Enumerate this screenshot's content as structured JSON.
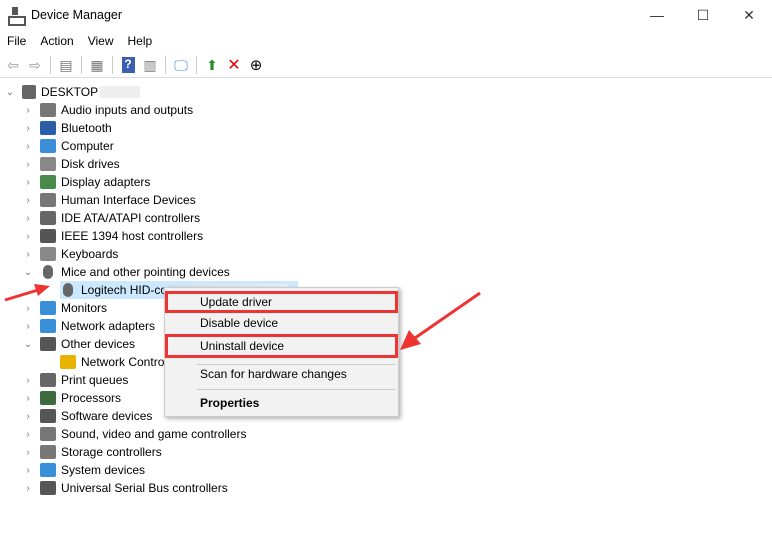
{
  "window": {
    "title": "Device Manager",
    "minimize": "—",
    "maximize": "☐",
    "close": "✕"
  },
  "menubar": [
    "File",
    "Action",
    "View",
    "Help"
  ],
  "toolbar": [
    "back",
    "forward",
    "show-hide-console-tree",
    "properties",
    "help",
    "action-pane",
    "scan-hardware",
    "update-driver",
    "uninstall",
    "disable"
  ],
  "tree": {
    "root": "DESKTOP",
    "items": [
      {
        "label": "Audio inputs and outputs",
        "expanded": false,
        "icon": "speaker",
        "color": "#777"
      },
      {
        "label": "Bluetooth",
        "expanded": false,
        "icon": "bluetooth",
        "color": "#2a5ea8"
      },
      {
        "label": "Computer",
        "expanded": false,
        "icon": "monitor",
        "color": "#3a8fd8"
      },
      {
        "label": "Disk drives",
        "expanded": false,
        "icon": "disk",
        "color": "#888"
      },
      {
        "label": "Display adapters",
        "expanded": false,
        "icon": "display",
        "color": "#4a8a4a"
      },
      {
        "label": "Human Interface Devices",
        "expanded": false,
        "icon": "hid",
        "color": "#777"
      },
      {
        "label": "IDE ATA/ATAPI controllers",
        "expanded": false,
        "icon": "ide",
        "color": "#666"
      },
      {
        "label": "IEEE 1394 host controllers",
        "expanded": false,
        "icon": "ieee",
        "color": "#555"
      },
      {
        "label": "Keyboards",
        "expanded": false,
        "icon": "keyboard",
        "color": "#888"
      },
      {
        "label": "Mice and other pointing devices",
        "expanded": true,
        "icon": "mouse",
        "color": "#666"
      },
      {
        "label": "Logitech HID-co",
        "child": true,
        "selected": true,
        "icon": "mouse",
        "color": "#666"
      },
      {
        "label": "Monitors",
        "expanded": false,
        "icon": "monitor",
        "color": "#3a8fd8"
      },
      {
        "label": "Network adapters",
        "expanded": false,
        "icon": "network",
        "color": "#3a8fd8"
      },
      {
        "label": "Other devices",
        "expanded": true,
        "icon": "unknown",
        "color": "#555"
      },
      {
        "label": "Network Contro",
        "child": true,
        "icon": "warning",
        "color": "#e8b400"
      },
      {
        "label": "Print queues",
        "expanded": false,
        "icon": "printer",
        "color": "#666"
      },
      {
        "label": "Processors",
        "expanded": false,
        "icon": "cpu",
        "color": "#3d6b3d"
      },
      {
        "label": "Software devices",
        "expanded": false,
        "icon": "software",
        "color": "#555"
      },
      {
        "label": "Sound, video and game controllers",
        "expanded": false,
        "icon": "speaker",
        "color": "#777"
      },
      {
        "label": "Storage controllers",
        "expanded": false,
        "icon": "storage",
        "color": "#777"
      },
      {
        "label": "System devices",
        "expanded": false,
        "icon": "system",
        "color": "#3a8fd8"
      },
      {
        "label": "Universal Serial Bus controllers",
        "expanded": false,
        "icon": "usb",
        "color": "#555"
      }
    ]
  },
  "context_menu": {
    "update": "Update driver",
    "disable": "Disable device",
    "uninstall": "Uninstall device",
    "scan": "Scan for hardware changes",
    "properties": "Properties"
  },
  "highlight_color": "#e33333"
}
